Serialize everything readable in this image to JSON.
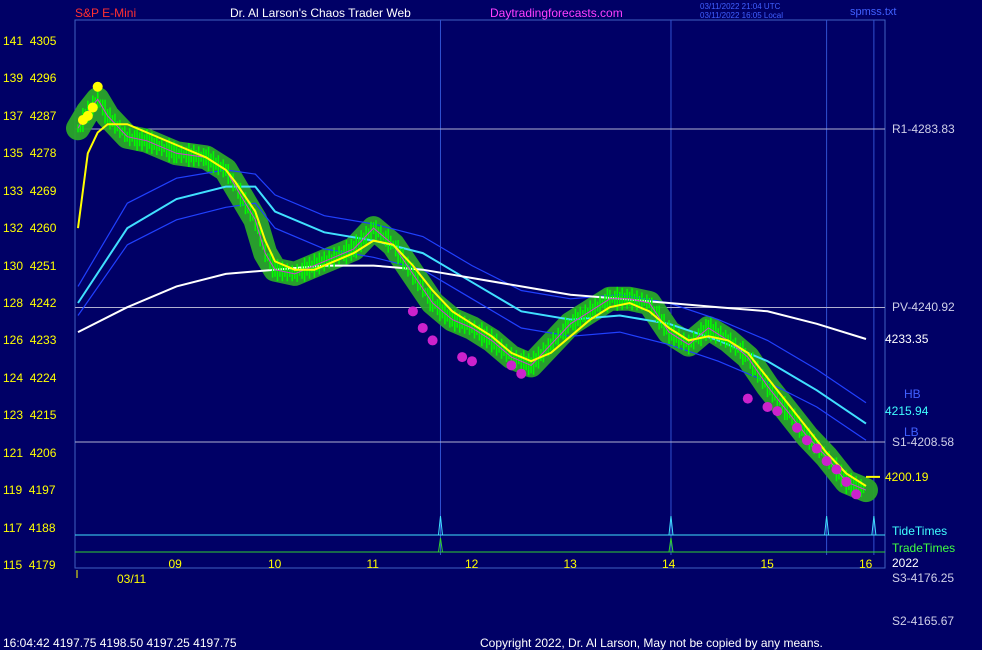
{
  "header": {
    "instrument": "S&P E-Mini",
    "title": "Dr. Al Larson's Chaos Trader Web",
    "site": "Daytradingforecasts.com",
    "utc_stamp": "03/11/2022 21:04 UTC",
    "local_stamp": "03/11/2022 16:05 Local",
    "file": "spmss.txt"
  },
  "footer": {
    "quote": "16:04:42  4197.75 4198.50 4197.25 4197.75",
    "copyright": "Copyright 2022, Dr. Al Larson, May not be copied by any means."
  },
  "colors": {
    "background": "#000066",
    "price": "#00ff00",
    "halo": "#2aa52a",
    "fast_ma": "#ffff00",
    "mid_band": "#40e0ff",
    "outer_band": "#2040ff",
    "slow_curve": "#ffffff",
    "markers": "#cc22cc"
  },
  "chart_data": {
    "type": "line",
    "title": "S&P E-Mini",
    "date": "03/11",
    "year": "2022",
    "x_unit": "hour of day",
    "xlim": [
      8.0,
      16.15
    ],
    "ylim": [
      4179,
      4310
    ],
    "y_ticks": [
      {
        "label": "141  4305",
        "value": 4305
      },
      {
        "label": "139  4296",
        "value": 4296
      },
      {
        "label": "137  4287",
        "value": 4287
      },
      {
        "label": "135  4278",
        "value": 4278
      },
      {
        "label": "133  4269",
        "value": 4269
      },
      {
        "label": "132  4260",
        "value": 4260
      },
      {
        "label": "130  4251",
        "value": 4251
      },
      {
        "label": "128  4242",
        "value": 4242
      },
      {
        "label": "126  4233",
        "value": 4233
      },
      {
        "label": "124  4224",
        "value": 4224
      },
      {
        "label": "123  4215",
        "value": 4215
      },
      {
        "label": "121  4206",
        "value": 4206
      },
      {
        "label": "119  4197",
        "value": 4197
      },
      {
        "label": "117  4188",
        "value": 4188
      },
      {
        "label": "115  4179",
        "value": 4179
      }
    ],
    "x_ticks": [
      {
        "label": "09",
        "value": 9
      },
      {
        "label": "10",
        "value": 10
      },
      {
        "label": "11",
        "value": 11
      },
      {
        "label": "12",
        "value": 12
      },
      {
        "label": "13",
        "value": 13
      },
      {
        "label": "14",
        "value": 14
      },
      {
        "label": "15",
        "value": 15
      },
      {
        "label": "16",
        "value": 16
      }
    ],
    "levels": [
      {
        "label": "R1-4283.83",
        "value": 4283.83
      },
      {
        "label": "PV-4240.92",
        "value": 4240.92
      },
      {
        "label": "S1-4208.58",
        "value": 4208.58
      }
    ],
    "below_levels": [
      {
        "label": "S3-4176.25",
        "value": 4176.25
      },
      {
        "label": "S2-4165.67",
        "value": 4165.67
      }
    ],
    "series": [
      {
        "name": "price",
        "x": [
          8.0,
          8.1,
          8.2,
          8.3,
          8.5,
          8.7,
          9.0,
          9.3,
          9.5,
          9.6,
          9.8,
          9.9,
          10.0,
          10.2,
          10.4,
          10.6,
          10.8,
          11.0,
          11.2,
          11.4,
          11.6,
          11.8,
          12.0,
          12.2,
          12.4,
          12.6,
          12.8,
          13.0,
          13.2,
          13.4,
          13.6,
          13.8,
          14.0,
          14.2,
          14.4,
          14.6,
          14.8,
          15.0,
          15.2,
          15.4,
          15.6,
          15.8,
          16.0
        ],
        "y": [
          4284,
          4288,
          4291,
          4287,
          4282,
          4281,
          4278,
          4277,
          4274,
          4270,
          4262,
          4254,
          4250,
          4249,
          4251,
          4253,
          4255,
          4260,
          4256,
          4249,
          4242,
          4238,
          4236,
          4233,
          4229,
          4227,
          4232,
          4237,
          4240,
          4243,
          4243,
          4242,
          4235,
          4232,
          4236,
          4233,
          4229,
          4222,
          4216,
          4210,
          4205,
          4199,
          4197
        ]
      },
      {
        "name": "fast average",
        "x": [
          8.0,
          8.1,
          8.2,
          8.3,
          8.5,
          8.7,
          9.0,
          9.3,
          9.5,
          9.6,
          9.8,
          9.9,
          10.0,
          10.2,
          10.4,
          10.6,
          10.8,
          11.0,
          11.2,
          11.4,
          11.6,
          11.8,
          12.0,
          12.2,
          12.4,
          12.6,
          12.8,
          13.0,
          13.2,
          13.4,
          13.6,
          13.8,
          14.0,
          14.2,
          14.4,
          14.6,
          14.8,
          15.0,
          15.2,
          15.4,
          15.6,
          15.8,
          16.0
        ],
        "y": [
          4260,
          4278,
          4283,
          4285,
          4285,
          4283,
          4280,
          4277,
          4274,
          4271,
          4264,
          4257,
          4252,
          4250,
          4250,
          4252,
          4254,
          4257,
          4256,
          4251,
          4245,
          4240,
          4237,
          4234,
          4230,
          4228,
          4230,
          4234,
          4238,
          4241,
          4242,
          4240,
          4236,
          4233,
          4234,
          4233,
          4230,
          4224,
          4218,
          4212,
          4206,
          4201,
          4198
        ]
      },
      {
        "name": "mid band",
        "x": [
          8.0,
          8.5,
          9.0,
          9.5,
          9.8,
          10.0,
          10.5,
          11.0,
          11.5,
          12.0,
          12.5,
          13.0,
          13.5,
          14.0,
          14.5,
          15.0,
          15.5,
          16.0
        ],
        "y": [
          4242,
          4260,
          4267,
          4270,
          4270,
          4264,
          4259,
          4257,
          4254,
          4247,
          4240,
          4238,
          4239,
          4237,
          4233,
          4228,
          4221,
          4213
        ]
      },
      {
        "name": "upper band",
        "x": [
          8.0,
          8.5,
          9.0,
          9.5,
          9.8,
          10.0,
          10.5,
          11.0,
          11.5,
          12.0,
          12.5,
          13.0,
          13.5,
          14.0,
          14.5,
          15.0,
          15.5,
          16.0
        ],
        "y": [
          4246,
          4266,
          4272,
          4274,
          4273,
          4268,
          4263,
          4261,
          4258,
          4251,
          4245,
          4243,
          4244,
          4242,
          4238,
          4233,
          4226,
          4218
        ]
      },
      {
        "name": "lower band",
        "x": [
          8.0,
          8.5,
          9.0,
          9.5,
          9.8,
          10.0,
          10.5,
          11.0,
          11.5,
          12.0,
          12.5,
          13.0,
          13.5,
          14.0,
          14.5,
          15.0,
          15.5,
          16.0
        ],
        "y": [
          4239,
          4256,
          4262,
          4265,
          4266,
          4260,
          4255,
          4253,
          4250,
          4243,
          4236,
          4234,
          4235,
          4232,
          4228,
          4223,
          4217,
          4209
        ]
      },
      {
        "name": "slow curve",
        "x": [
          8.0,
          8.5,
          9.0,
          9.5,
          10.0,
          10.5,
          11.0,
          11.5,
          12.0,
          12.5,
          13.0,
          13.5,
          14.0,
          14.5,
          15.0,
          15.5,
          16.0
        ],
        "y": [
          4235,
          4241,
          4246,
          4249,
          4250,
          4251,
          4251,
          4250,
          4248,
          4246,
          4244,
          4243,
          4242,
          4241,
          4240,
          4237,
          4233.35
        ]
      }
    ],
    "end_labels": [
      {
        "label": "4233.35",
        "value": 4233.35,
        "color": "#ffffff"
      },
      {
        "label": "4215.94",
        "value": 4215.94,
        "color": "#40ffff"
      },
      {
        "label": "4200.19",
        "value": 4200.19,
        "color": "#ffff00"
      }
    ],
    "band_labels": [
      {
        "label": "HB",
        "value": 4220
      },
      {
        "label": "LB",
        "value": 4211
      }
    ],
    "tide_times": {
      "label": "TideTimes",
      "x": [
        11.68,
        14.02,
        15.6,
        16.08
      ]
    },
    "trade_times": {
      "label": "TradeTimes",
      "x": [
        11.68,
        14.02
      ]
    },
    "timing_lines_x": [
      11.68,
      14.02,
      15.6,
      16.08
    ],
    "markers": {
      "x": [
        11.4,
        11.5,
        11.6,
        11.9,
        12.0,
        12.4,
        12.5,
        14.8,
        15.0,
        15.1,
        15.3,
        15.4,
        15.5,
        15.6,
        15.7,
        15.8,
        15.9
      ],
      "y": [
        4240,
        4236,
        4233,
        4229,
        4228,
        4227,
        4225,
        4219,
        4217,
        4216,
        4212,
        4209,
        4207,
        4204,
        4202,
        4199,
        4196
      ]
    },
    "opening_markers": {
      "x": [
        8.05,
        8.1,
        8.15,
        8.2
      ],
      "y": [
        4286,
        4287,
        4289,
        4294
      ]
    }
  }
}
